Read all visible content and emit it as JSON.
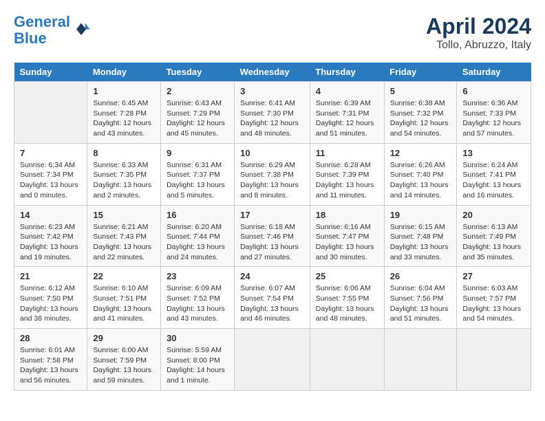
{
  "header": {
    "logo_line1": "General",
    "logo_line2": "Blue",
    "month": "April 2024",
    "location": "Tollo, Abruzzo, Italy"
  },
  "weekdays": [
    "Sunday",
    "Monday",
    "Tuesday",
    "Wednesday",
    "Thursday",
    "Friday",
    "Saturday"
  ],
  "weeks": [
    [
      {
        "day": "",
        "sunrise": "",
        "sunset": "",
        "daylight": ""
      },
      {
        "day": "1",
        "sunrise": "6:45 AM",
        "sunset": "7:28 PM",
        "daylight": "12 hours and 43 minutes."
      },
      {
        "day": "2",
        "sunrise": "6:43 AM",
        "sunset": "7:29 PM",
        "daylight": "12 hours and 45 minutes."
      },
      {
        "day": "3",
        "sunrise": "6:41 AM",
        "sunset": "7:30 PM",
        "daylight": "12 hours and 48 minutes."
      },
      {
        "day": "4",
        "sunrise": "6:39 AM",
        "sunset": "7:31 PM",
        "daylight": "12 hours and 51 minutes."
      },
      {
        "day": "5",
        "sunrise": "6:38 AM",
        "sunset": "7:32 PM",
        "daylight": "12 hours and 54 minutes."
      },
      {
        "day": "6",
        "sunrise": "6:36 AM",
        "sunset": "7:33 PM",
        "daylight": "12 hours and 57 minutes."
      }
    ],
    [
      {
        "day": "7",
        "sunrise": "6:34 AM",
        "sunset": "7:34 PM",
        "daylight": "13 hours and 0 minutes."
      },
      {
        "day": "8",
        "sunrise": "6:33 AM",
        "sunset": "7:35 PM",
        "daylight": "13 hours and 2 minutes."
      },
      {
        "day": "9",
        "sunrise": "6:31 AM",
        "sunset": "7:37 PM",
        "daylight": "13 hours and 5 minutes."
      },
      {
        "day": "10",
        "sunrise": "6:29 AM",
        "sunset": "7:38 PM",
        "daylight": "13 hours and 8 minutes."
      },
      {
        "day": "11",
        "sunrise": "6:28 AM",
        "sunset": "7:39 PM",
        "daylight": "13 hours and 11 minutes."
      },
      {
        "day": "12",
        "sunrise": "6:26 AM",
        "sunset": "7:40 PM",
        "daylight": "13 hours and 14 minutes."
      },
      {
        "day": "13",
        "sunrise": "6:24 AM",
        "sunset": "7:41 PM",
        "daylight": "13 hours and 16 minutes."
      }
    ],
    [
      {
        "day": "14",
        "sunrise": "6:23 AM",
        "sunset": "7:42 PM",
        "daylight": "13 hours and 19 minutes."
      },
      {
        "day": "15",
        "sunrise": "6:21 AM",
        "sunset": "7:43 PM",
        "daylight": "13 hours and 22 minutes."
      },
      {
        "day": "16",
        "sunrise": "6:20 AM",
        "sunset": "7:44 PM",
        "daylight": "13 hours and 24 minutes."
      },
      {
        "day": "17",
        "sunrise": "6:18 AM",
        "sunset": "7:46 PM",
        "daylight": "13 hours and 27 minutes."
      },
      {
        "day": "18",
        "sunrise": "6:16 AM",
        "sunset": "7:47 PM",
        "daylight": "13 hours and 30 minutes."
      },
      {
        "day": "19",
        "sunrise": "6:15 AM",
        "sunset": "7:48 PM",
        "daylight": "13 hours and 33 minutes."
      },
      {
        "day": "20",
        "sunrise": "6:13 AM",
        "sunset": "7:49 PM",
        "daylight": "13 hours and 35 minutes."
      }
    ],
    [
      {
        "day": "21",
        "sunrise": "6:12 AM",
        "sunset": "7:50 PM",
        "daylight": "13 hours and 38 minutes."
      },
      {
        "day": "22",
        "sunrise": "6:10 AM",
        "sunset": "7:51 PM",
        "daylight": "13 hours and 41 minutes."
      },
      {
        "day": "23",
        "sunrise": "6:09 AM",
        "sunset": "7:52 PM",
        "daylight": "13 hours and 43 minutes."
      },
      {
        "day": "24",
        "sunrise": "6:07 AM",
        "sunset": "7:54 PM",
        "daylight": "13 hours and 46 minutes."
      },
      {
        "day": "25",
        "sunrise": "6:06 AM",
        "sunset": "7:55 PM",
        "daylight": "13 hours and 48 minutes."
      },
      {
        "day": "26",
        "sunrise": "6:04 AM",
        "sunset": "7:56 PM",
        "daylight": "13 hours and 51 minutes."
      },
      {
        "day": "27",
        "sunrise": "6:03 AM",
        "sunset": "7:57 PM",
        "daylight": "13 hours and 54 minutes."
      }
    ],
    [
      {
        "day": "28",
        "sunrise": "6:01 AM",
        "sunset": "7:58 PM",
        "daylight": "13 hours and 56 minutes."
      },
      {
        "day": "29",
        "sunrise": "6:00 AM",
        "sunset": "7:59 PM",
        "daylight": "13 hours and 59 minutes."
      },
      {
        "day": "30",
        "sunrise": "5:59 AM",
        "sunset": "8:00 PM",
        "daylight": "14 hours and 1 minute."
      },
      {
        "day": "",
        "sunrise": "",
        "sunset": "",
        "daylight": ""
      },
      {
        "day": "",
        "sunrise": "",
        "sunset": "",
        "daylight": ""
      },
      {
        "day": "",
        "sunrise": "",
        "sunset": "",
        "daylight": ""
      },
      {
        "day": "",
        "sunrise": "",
        "sunset": "",
        "daylight": ""
      }
    ]
  ]
}
